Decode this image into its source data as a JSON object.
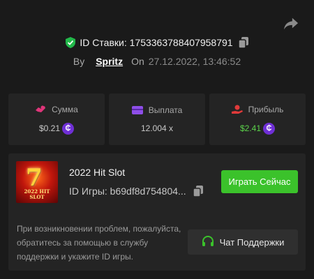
{
  "header": {
    "bet_id_label": "ID Ставки: 1753363788407958791",
    "by_label": "By",
    "username": "Spritz",
    "on_label": "On",
    "date": "27.12.2022, 13:46:52"
  },
  "stats": [
    {
      "label": "Сумма",
      "value": "$0.21",
      "icon": "money-icon",
      "coin": "₵"
    },
    {
      "label": "Выплата",
      "value": "12.004 x",
      "icon": "wallet-icon"
    },
    {
      "label": "Прибыль",
      "value": "$2.41",
      "icon": "profit-hand-icon",
      "coin": "₵"
    }
  ],
  "game": {
    "title": "2022 Hit Slot",
    "id_label": "ID Игры: b69df8d754804...",
    "thumb_text": "2022 HIT SLOT",
    "play_label": "Играть Сейчас"
  },
  "support": {
    "help_text": "При возникновении проблем, пожалуйста, обратитесь за помощью в службу поддержки и укажите ID игры.",
    "button_label": "Чат Поддержки"
  },
  "colors": {
    "accent_green": "#3bc22b",
    "profit_green": "#5bd34a",
    "coin_purple": "#6f2fd6",
    "money_pink": "#e0357a"
  }
}
